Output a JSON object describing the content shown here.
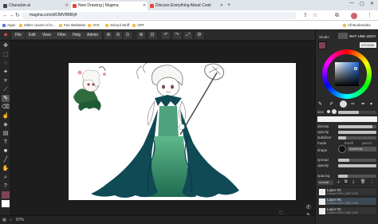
{
  "browser": {
    "tabs": [
      {
        "label": "Character.ai",
        "color": "#444444",
        "active": false
      },
      {
        "label": "New Drawing | Magma",
        "color": "#e04a3a",
        "active": true
      },
      {
        "label": "Discuss Everything About Cook",
        "color": "#e04a3a",
        "active": false
      }
    ],
    "new_tab": "+",
    "url": "magma.com/d/OMVBMRj4",
    "bookmarks": [
      "Apps",
      "Other covers of m...",
      "Fun Websites",
      "AYS",
      "School Stuff",
      "ART"
    ],
    "all_bookmarks": "All Bookmarks"
  },
  "menu": {
    "items": [
      "File",
      "Edit",
      "View",
      "Filter",
      "Help",
      "Admin"
    ]
  },
  "panel": {
    "header_label": "Studio",
    "user_name": "WAT UNE aODY",
    "hex": "#7F4258",
    "brush_size_label": "size",
    "brush_size_value": "22px",
    "density_label": "density",
    "opacity_label": "opacity",
    "stabilizer_label": "stabilizer",
    "mode_label": "mode",
    "mode_options": [
      "brush",
      "pencil"
    ],
    "shape_label": "shape",
    "shape_value": "hardness",
    "spread_label": "spread",
    "opacity2_label": "opacity",
    "spacing_label": "spacing",
    "blend_value": "normal",
    "layers": [
      {
        "name": "Layer #3",
        "sub": "normal 100% | WAT UNE"
      },
      {
        "name": "Layer #5",
        "sub": "normal 100% | WAT UNE"
      },
      {
        "name": "Layer #2",
        "sub": "normal 100% | WAT UNE"
      }
    ],
    "brush_size": 0.55,
    "density": 0.9,
    "opacity": 1.0,
    "stabilizer": 0.2,
    "spread": 0.3,
    "opacity2": 1.0,
    "spacing": 0.25
  },
  "status": {
    "zoom": "97%"
  },
  "colors": {
    "primary": "#7f4258",
    "figure_green": "#2e7d5b",
    "cape_teal": "#0f4a55"
  }
}
